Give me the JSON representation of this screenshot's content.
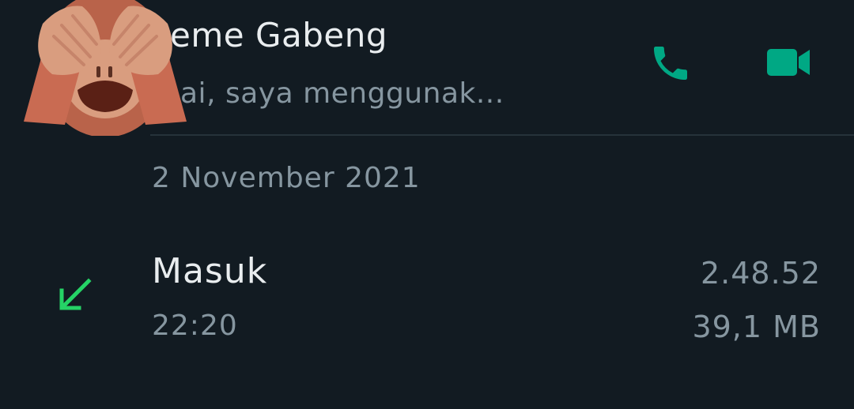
{
  "contact": {
    "name": "eme Gabeng",
    "status": "ai, saya menggunak...",
    "avatar_icon": "see-no-evil-monkey-icon"
  },
  "actions": {
    "call_icon": "phone-icon",
    "video_icon": "video-camera-icon"
  },
  "date_header": "2 November 2021",
  "call_log": {
    "direction_icon": "incoming-arrow-icon",
    "type": "Masuk",
    "time": "22:20",
    "duration": "2.48.52",
    "size": "39,1 MB"
  },
  "colors": {
    "background": "#121b22",
    "accent": "#00a884",
    "incoming_arrow": "#25d366",
    "primary_text": "#e9edef",
    "secondary_text": "#8696a0"
  }
}
